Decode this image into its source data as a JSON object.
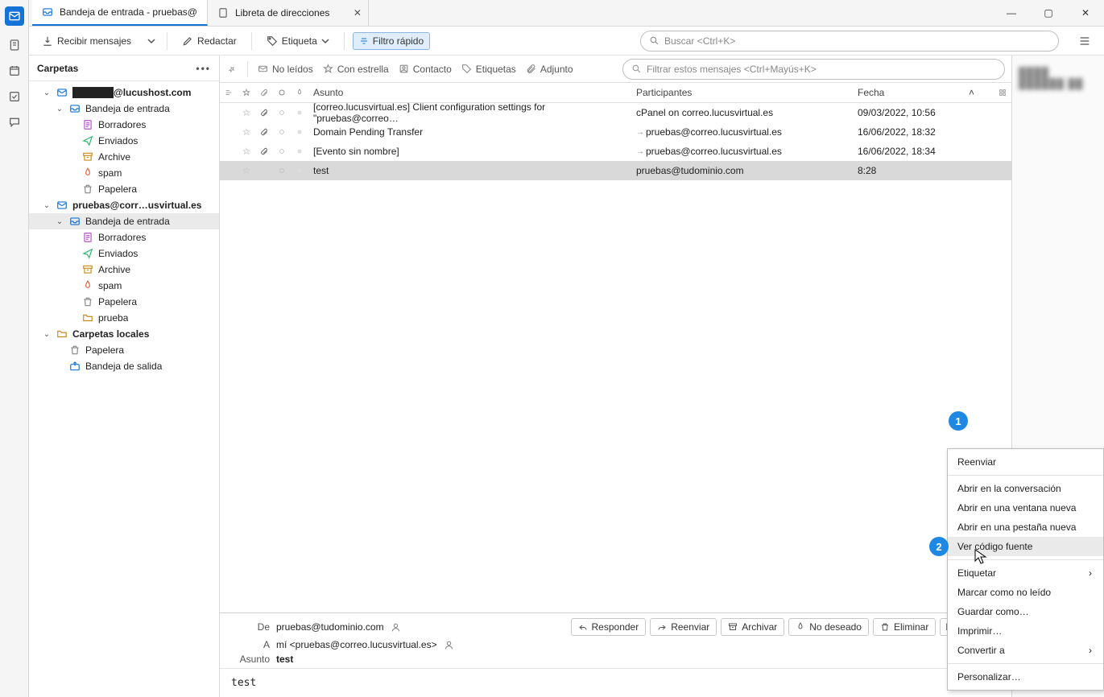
{
  "tabs": [
    {
      "label": "Bandeja de entrada - pruebas@",
      "active": true
    },
    {
      "label": "Libreta de direcciones",
      "active": false
    }
  ],
  "toolbar": {
    "receive": "Recibir mensajes",
    "compose": "Redactar",
    "tag": "Etiqueta",
    "quickfilter": "Filtro rápido",
    "search_placeholder": "Buscar <Ctrl+K>"
  },
  "folders_title": "Carpetas",
  "tree": [
    {
      "depth": 0,
      "tw": "⌄",
      "icon": "account",
      "label": "██████@lucushost.com",
      "bold": true
    },
    {
      "depth": 1,
      "tw": "⌄",
      "icon": "inbox",
      "label": "Bandeja de entrada"
    },
    {
      "depth": 2,
      "tw": "",
      "icon": "drafts",
      "label": "Borradores"
    },
    {
      "depth": 2,
      "tw": "",
      "icon": "sent",
      "label": "Enviados"
    },
    {
      "depth": 2,
      "tw": "",
      "icon": "archive",
      "label": "Archive"
    },
    {
      "depth": 2,
      "tw": "",
      "icon": "spam",
      "label": "spam"
    },
    {
      "depth": 2,
      "tw": "",
      "icon": "trash",
      "label": "Papelera"
    },
    {
      "depth": 0,
      "tw": "⌄",
      "icon": "account",
      "label": "pruebas@corr…usvirtual.es",
      "bold": true
    },
    {
      "depth": 1,
      "tw": "⌄",
      "icon": "inbox",
      "label": "Bandeja de entrada",
      "sel": true
    },
    {
      "depth": 2,
      "tw": "",
      "icon": "drafts",
      "label": "Borradores"
    },
    {
      "depth": 2,
      "tw": "",
      "icon": "sent",
      "label": "Enviados"
    },
    {
      "depth": 2,
      "tw": "",
      "icon": "archive",
      "label": "Archive"
    },
    {
      "depth": 2,
      "tw": "",
      "icon": "spam",
      "label": "spam"
    },
    {
      "depth": 2,
      "tw": "",
      "icon": "trash",
      "label": "Papelera"
    },
    {
      "depth": 2,
      "tw": "",
      "icon": "folder",
      "label": "prueba"
    },
    {
      "depth": 0,
      "tw": "⌄",
      "icon": "local",
      "label": "Carpetas locales",
      "bold": true
    },
    {
      "depth": 1,
      "tw": "",
      "icon": "trash",
      "label": "Papelera"
    },
    {
      "depth": 1,
      "tw": "",
      "icon": "outbox",
      "label": "Bandeja de salida"
    }
  ],
  "filter": {
    "unread": "No leídos",
    "starred": "Con estrella",
    "contact": "Contacto",
    "tags": "Etiquetas",
    "attach": "Adjunto",
    "placeholder": "Filtrar estos mensajes <Ctrl+Mayús+K>"
  },
  "columns": {
    "subject": "Asunto",
    "participants": "Participantes",
    "date": "Fecha"
  },
  "rows": [
    {
      "attach": true,
      "subject": "[correo.lucusvirtual.es] Client configuration settings for \"pruebas@correo…",
      "part": "cPanel on correo.lucusvirtual.es",
      "date": "09/03/2022, 10:56"
    },
    {
      "attach": true,
      "subject": "Domain Pending Transfer",
      "part": "pruebas@correo.lucusvirtual.es",
      "date": "16/06/2022, 18:32",
      "arrow": true
    },
    {
      "attach": true,
      "subject": "[Evento sin nombre]",
      "part": "pruebas@correo.lucusvirtual.es",
      "date": "16/06/2022, 18:34",
      "arrow": true
    },
    {
      "attach": false,
      "subject": "test",
      "part": "pruebas@tudominio.com",
      "date": "8:28",
      "sel": true
    }
  ],
  "reader": {
    "from_label": "De",
    "from": "pruebas@tudominio.com",
    "to_label": "A",
    "to": "mí <pruebas@correo.lucusvirtual.es>",
    "subject_label": "Asunto",
    "subject": "test",
    "body": "test",
    "actions": {
      "reply": "Responder",
      "forward": "Reenviar",
      "archive": "Archivar",
      "junk": "No deseado",
      "delete": "Eliminar",
      "more": "Más"
    }
  },
  "menu": [
    {
      "label": "Reenviar"
    },
    {
      "sep": true
    },
    {
      "label": "Abrir en la conversación"
    },
    {
      "label": "Abrir en una ventana nueva"
    },
    {
      "label": "Abrir en una pestaña nueva"
    },
    {
      "label": "Ver código fuente",
      "hl": true
    },
    {
      "sep": true
    },
    {
      "label": "Etiquetar",
      "sub": true
    },
    {
      "label": "Marcar como no leído"
    },
    {
      "label": "Guardar como…"
    },
    {
      "label": "Imprimir…"
    },
    {
      "label": "Convertir a",
      "sub": true
    },
    {
      "sep": true
    },
    {
      "label": "Personalizar…"
    }
  ],
  "badges": {
    "b1": "1",
    "b2": "2"
  }
}
